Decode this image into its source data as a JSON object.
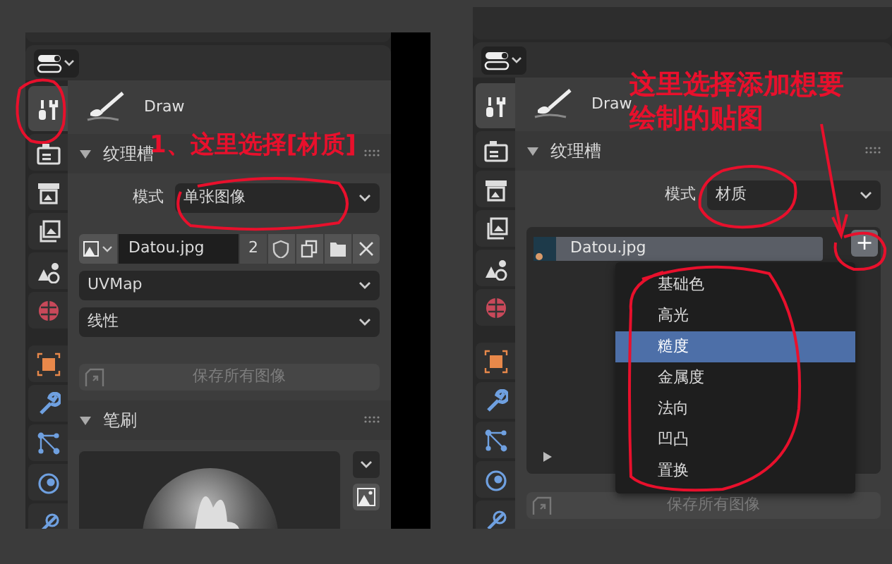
{
  "panels": [
    {
      "tabs": [
        {
          "kind": "tool",
          "selected": true
        },
        {
          "kind": "render",
          "selected": false
        },
        {
          "kind": "output",
          "selected": false
        },
        {
          "kind": "view_layer",
          "selected": false
        },
        {
          "kind": "scene",
          "selected": false
        },
        {
          "kind": "world",
          "selected": false
        },
        {
          "kind": "object",
          "selected": false
        },
        {
          "kind": "modifier",
          "selected": false
        },
        {
          "kind": "particles",
          "selected": false
        },
        {
          "kind": "physics",
          "selected": false
        },
        {
          "kind": "constraints",
          "selected": false
        }
      ],
      "tool_name": "Draw",
      "texture_slots": {
        "title": "纹理槽",
        "expanded": true,
        "mode_label": "模式",
        "mode_value": "单张图像",
        "image": {
          "name": "Datou.jpg",
          "users": "2"
        },
        "uv_map": "UVMap",
        "interpolation": "线性"
      },
      "save_button": {
        "label": "保存所有图像",
        "disabled": true
      },
      "brush": {
        "title": "笔刷",
        "expanded": true
      },
      "note_lines": [
        "1、这里选择[材质]"
      ]
    },
    {
      "tabs": [
        {
          "kind": "tool",
          "selected": true
        },
        {
          "kind": "render",
          "selected": false
        },
        {
          "kind": "output",
          "selected": false
        },
        {
          "kind": "view_layer",
          "selected": false
        },
        {
          "kind": "scene",
          "selected": false
        },
        {
          "kind": "world",
          "selected": false
        },
        {
          "kind": "object",
          "selected": false
        },
        {
          "kind": "modifier",
          "selected": false
        },
        {
          "kind": "particles",
          "selected": false
        },
        {
          "kind": "physics",
          "selected": false
        },
        {
          "kind": "constraints",
          "selected": false
        }
      ],
      "tool_name": "Draw",
      "texture_slots": {
        "title": "纹理槽",
        "expanded": true,
        "mode_label": "模式",
        "mode_value": "材质",
        "slots": [
          {
            "name": "Datou.jpg",
            "selected": true
          }
        ],
        "add_button": "+",
        "add_menu": [
          {
            "label": "基础色",
            "selected": false
          },
          {
            "label": "高光",
            "selected": false
          },
          {
            "label": "糙度",
            "selected": true
          },
          {
            "label": "金属度",
            "selected": false
          },
          {
            "label": "法向",
            "selected": false
          },
          {
            "label": "凹凸",
            "selected": false
          },
          {
            "label": "置换",
            "selected": false
          }
        ]
      },
      "save_button": {
        "label": "保存所有图像",
        "disabled": true
      },
      "note_lines": [
        "这里选择添加想要",
        "绘制的贴图"
      ]
    }
  ]
}
